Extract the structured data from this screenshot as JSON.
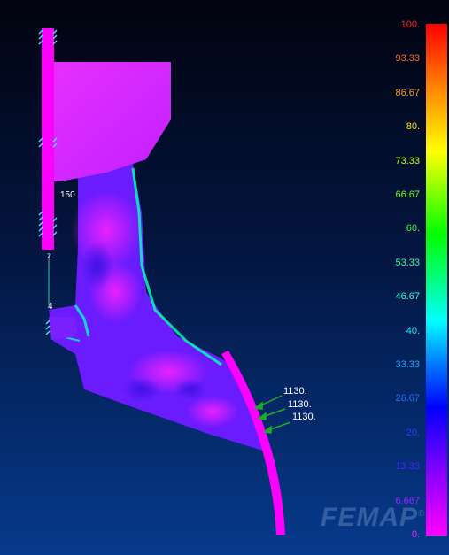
{
  "legend": {
    "levels": [
      {
        "label": "100.",
        "color": "#ff2020"
      },
      {
        "label": "93.33",
        "color": "#ff6a1a"
      },
      {
        "label": "86.67",
        "color": "#ff9b10"
      },
      {
        "label": "80.",
        "color": "#ffe300"
      },
      {
        "label": "73.33",
        "color": "#b8ff00"
      },
      {
        "label": "66.67",
        "color": "#5cff10"
      },
      {
        "label": "60.",
        "color": "#20ff40"
      },
      {
        "label": "53.33",
        "color": "#20ff9a"
      },
      {
        "label": "46.67",
        "color": "#20ffd0"
      },
      {
        "label": "40.",
        "color": "#20e8ff"
      },
      {
        "label": "33.33",
        "color": "#20a8ff"
      },
      {
        "label": "26.67",
        "color": "#2070ff"
      },
      {
        "label": "20.",
        "color": "#2040ff"
      },
      {
        "label": "13.33",
        "color": "#5020ff"
      },
      {
        "label": "6.667",
        "color": "#a020ff"
      },
      {
        "label": "0.",
        "color": "#ff20ff"
      }
    ]
  },
  "loads": [
    "1130.",
    "1130.",
    "1130."
  ],
  "annotations": {
    "node_150": "150",
    "axis_z": "z",
    "node_4": "4"
  },
  "logo": {
    "text": "FEMAP",
    "mark": "®"
  },
  "colors": {
    "low": "#ff00ff",
    "mid": "#6020ff",
    "high_edge": "#00ffb0",
    "load_arrow": "#1faa2a",
    "constraint": "#40e0ff"
  }
}
